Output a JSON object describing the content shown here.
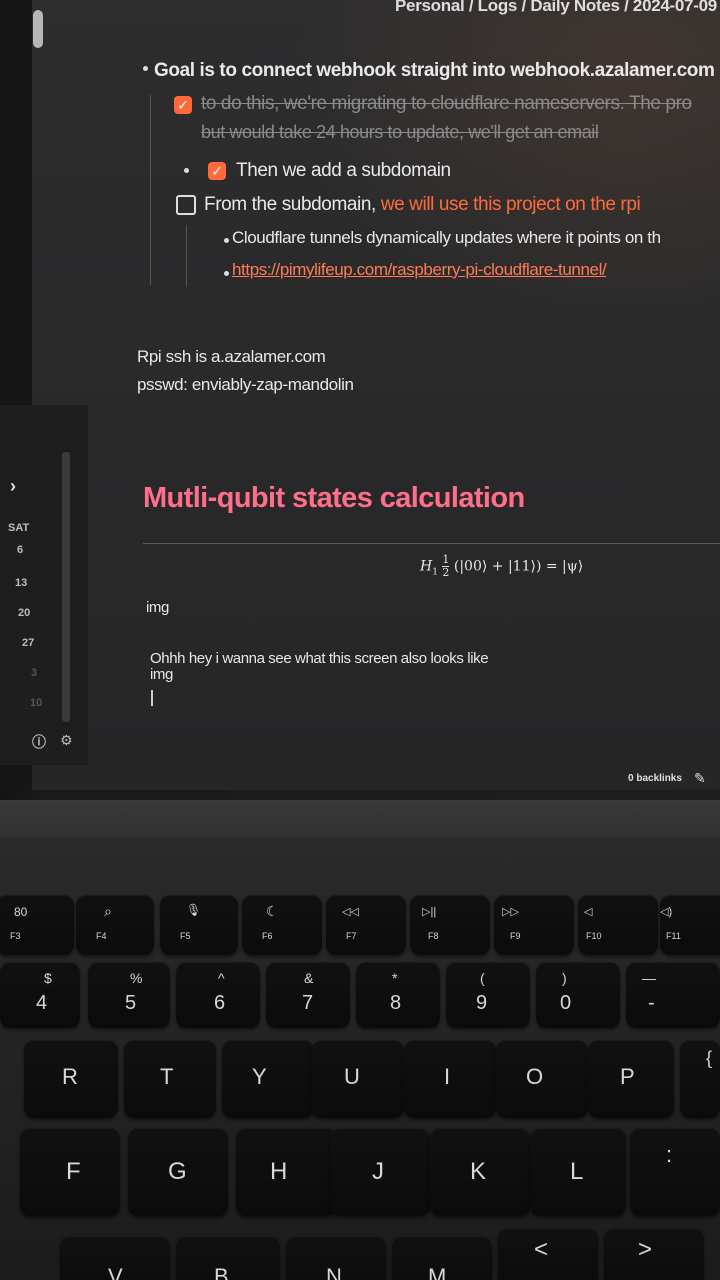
{
  "breadcrumb": "Personal / Logs / Daily Notes / 2024-07-09",
  "notes": {
    "goal": "Goal is to connect webhook straight into webhook.azalamer.com",
    "migrate_1": "to do this, we're migrating to cloudflare nameservers. The pro",
    "migrate_2": "but would take 24 hours to update, we'll get an email",
    "subdomain": "Then we add a subdomain",
    "from_sub_a": "From the subdomain, ",
    "from_sub_b": "we will use this project on the rpi",
    "tunnels": "Cloudflare tunnels dynamically updates where it points on th",
    "link": "https://pimylifeup.com/raspberry-pi-cloudflare-tunnel/",
    "rpi_ssh": "Rpi ssh is a.azalamer.com",
    "psswd": "psswd: enviably-zap-mandolin"
  },
  "section": {
    "heading": "Mutli-qubit states calculation",
    "formula_prefix": "H",
    "formula_sub": "1",
    "formula_num": "1",
    "formula_den": "2",
    "formula_body": "(|00⟩ + |11⟩) = |ψ⟩",
    "img1": "img",
    "line": "Ohhh hey i wanna see what this screen also looks like",
    "img2": "img"
  },
  "calendar": {
    "day_label": "SAT",
    "dates": [
      "6",
      "13",
      "20",
      "27",
      "3",
      "10"
    ]
  },
  "footer": {
    "backlinks": "0 backlinks"
  },
  "keyboard": {
    "function_row": [
      {
        "glyph": "80",
        "label": "F3"
      },
      {
        "glyph": "⌕",
        "label": "F4"
      },
      {
        "glyph": "🎙",
        "label": "F5"
      },
      {
        "glyph": "☾",
        "label": "F6"
      },
      {
        "glyph": "◁◁",
        "label": "F7"
      },
      {
        "glyph": "▷||",
        "label": "F8"
      },
      {
        "glyph": "▷▷",
        "label": "F9"
      },
      {
        "glyph": "◁",
        "label": "F10"
      },
      {
        "glyph": "◁)",
        "label": "F11"
      }
    ],
    "number_row": [
      {
        "top": "$",
        "bottom": "4"
      },
      {
        "top": "%",
        "bottom": "5"
      },
      {
        "top": "^",
        "bottom": "6"
      },
      {
        "top": "&",
        "bottom": "7"
      },
      {
        "top": "*",
        "bottom": "8"
      },
      {
        "top": "(",
        "bottom": "9"
      },
      {
        "top": ")",
        "bottom": "0"
      },
      {
        "top": "—",
        "bottom": "-"
      }
    ],
    "qwerty_row": [
      "R",
      "T",
      "Y",
      "U",
      "I",
      "O",
      "P",
      "{"
    ],
    "home_row": [
      "F",
      "G",
      "H",
      "J",
      "K",
      "L",
      ":"
    ],
    "bottom_row": [
      "V",
      "B",
      "N",
      "M",
      "<",
      ">"
    ]
  }
}
